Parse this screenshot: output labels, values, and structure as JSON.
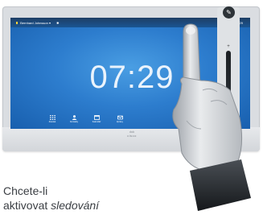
{
  "screen": {
    "user_name": "Bernhard Johnsson",
    "small_time": "07:29",
    "clock": "07:29",
    "apps": [
      {
        "label": "Zavolat",
        "icon": "dial-icon"
      },
      {
        "label": "Kontakty",
        "icon": "contacts-icon"
      },
      {
        "label": "Kalendář",
        "icon": "calendar-icon"
      },
      {
        "label": "Zprávy",
        "icon": "voicemail-icon"
      }
    ]
  },
  "device": {
    "brand": "cisco"
  },
  "caption": {
    "line1": "Chcete-li",
    "line2_prefix": "aktivovat ",
    "line2_em": "sledování"
  },
  "colors": {
    "screen_blue": "#2d7dce",
    "topbar": "#1e3e64",
    "bezel": "#dadde1"
  }
}
